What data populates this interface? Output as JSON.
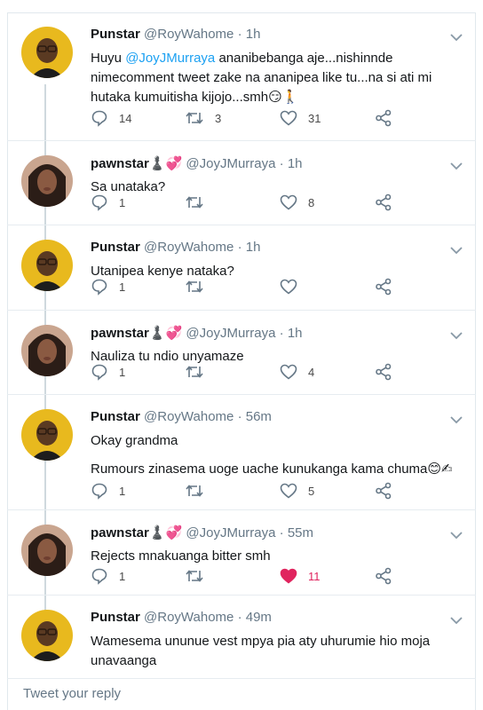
{
  "colors": {
    "handle": "#657786",
    "link": "#1da1f2",
    "liked": "#e0245e",
    "icon": "#657786"
  },
  "tweets": [
    {
      "name": "Punstar",
      "handle": "@RoyWahome",
      "sep": "·",
      "time": "1h",
      "avatar": "punstar-avatar",
      "text_pre": "Huyu ",
      "mention": "@JoyJMurraya",
      "text_post": " ananibebanga aje...nishinnde nimecomment tweet zake na ananipea like tu...na si ati mi hutaka kumuitisha kijojo...smh😏🚶",
      "replies": "14",
      "retweets": "3",
      "likes": "31",
      "liked": false
    },
    {
      "name": "pawnstar♟️💞",
      "handle": "@JoyJMurraya",
      "sep": "·",
      "time": "1h",
      "avatar": "pawnstar-avatar",
      "text": "Sa unataka?",
      "replies": "1",
      "retweets": "",
      "likes": "8",
      "liked": false
    },
    {
      "name": "Punstar",
      "handle": "@RoyWahome",
      "sep": "·",
      "time": "1h",
      "avatar": "punstar-avatar",
      "text": "Utanipea kenye nataka?",
      "replies": "1",
      "retweets": "",
      "likes": "",
      "liked": false
    },
    {
      "name": "pawnstar♟️💞",
      "handle": "@JoyJMurraya",
      "sep": "·",
      "time": "1h",
      "avatar": "pawnstar-avatar",
      "text": "Nauliza tu ndio unyamaze",
      "replies": "1",
      "retweets": "",
      "likes": "4",
      "liked": false
    },
    {
      "name": "Punstar",
      "handle": "@RoyWahome",
      "sep": "·",
      "time": "56m",
      "avatar": "punstar-avatar",
      "text": "Okay grandma",
      "text2": "Rumours zinasema uoge uache kunukanga kama chuma😊✍",
      "replies": "1",
      "retweets": "",
      "likes": "5",
      "liked": false
    },
    {
      "name": "pawnstar♟️💞",
      "handle": "@JoyJMurraya",
      "sep": "·",
      "time": "55m",
      "avatar": "pawnstar-avatar",
      "text": "Rejects mnakuanga bitter smh",
      "replies": "1",
      "retweets": "",
      "likes": "11",
      "liked": true
    },
    {
      "name": "Punstar",
      "handle": "@RoyWahome",
      "sep": "·",
      "time": "49m",
      "avatar": "punstar-avatar",
      "text": "Wamesema ununue vest mpya pia aty uhurumie hio moja unavaanga"
    }
  ],
  "reply_box": {
    "placeholder": "Tweet your reply"
  }
}
